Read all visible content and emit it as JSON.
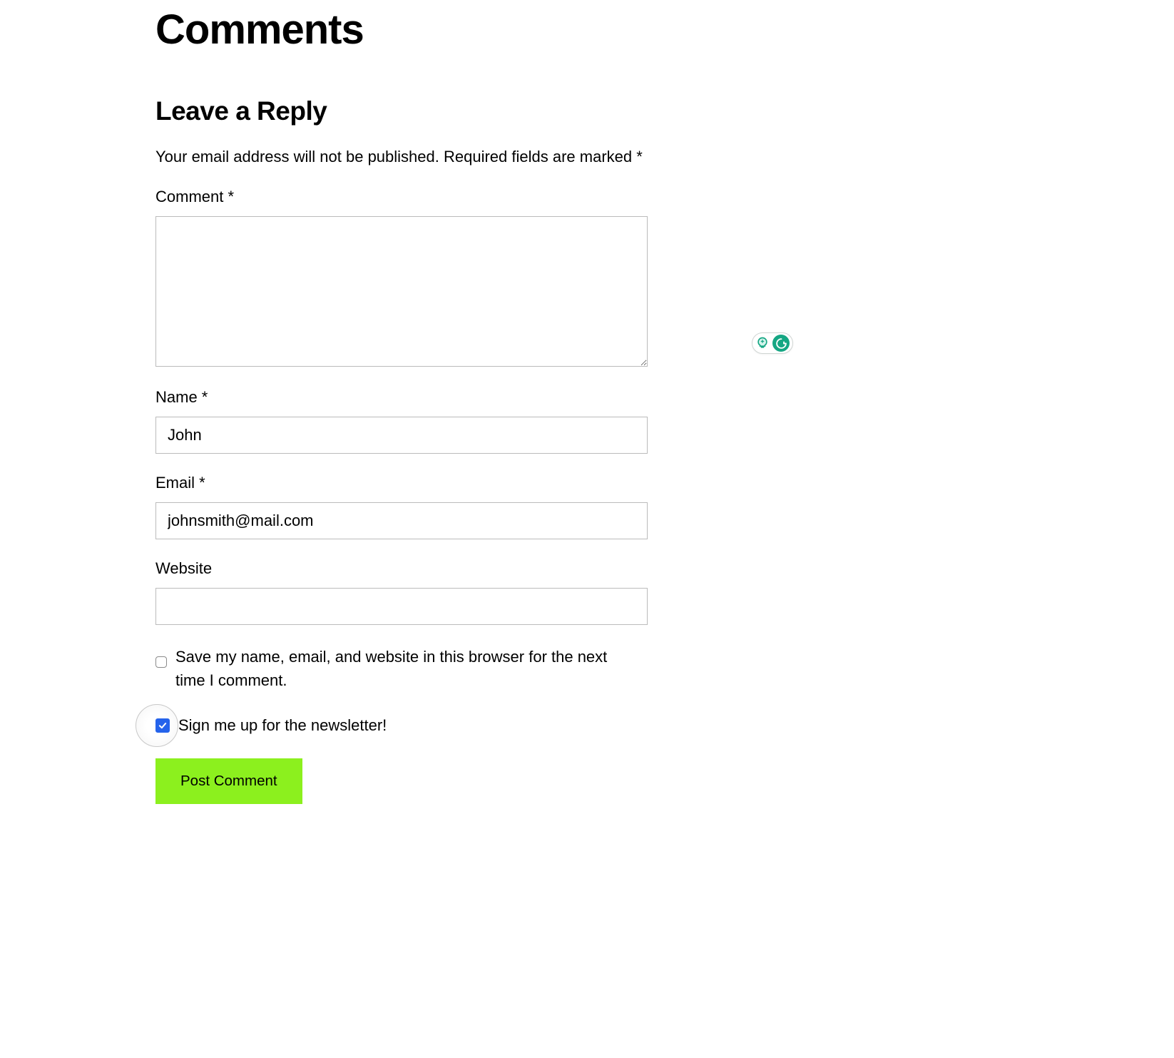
{
  "page": {
    "title": "Comments"
  },
  "form": {
    "reply_title": "Leave a Reply",
    "notice": "Your email address will not be published. Required fields are marked *",
    "comment": {
      "label": "Comment *",
      "value": ""
    },
    "name": {
      "label": "Name *",
      "value": "John"
    },
    "email": {
      "label": "Email *",
      "value": "johnsmith@mail.com"
    },
    "website": {
      "label": "Website",
      "value": ""
    },
    "save_info": {
      "label": "Save my name, email, and website in this browser for the next time I comment.",
      "checked": false
    },
    "newsletter": {
      "label": "Sign me up for the newsletter!",
      "checked": true
    },
    "submit_label": "Post Comment"
  },
  "icons": {
    "grammarly": "G",
    "bulb": "bulb-icon"
  },
  "colors": {
    "accent_green": "#8cf01e",
    "checkbox_blue": "#2563eb",
    "grammarly_green": "#15a683"
  }
}
